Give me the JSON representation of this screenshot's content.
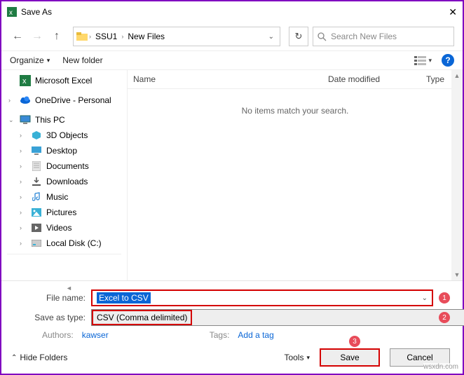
{
  "title": "Save As",
  "nav": {
    "crumb1": "SSU1",
    "crumb2": "New Files",
    "search_placeholder": "Search New Files"
  },
  "toolbar": {
    "organize": "Organize",
    "new_folder": "New folder"
  },
  "tree": {
    "excel": "Microsoft Excel",
    "onedrive": "OneDrive - Personal",
    "thispc": "This PC",
    "objects3d": "3D Objects",
    "desktop": "Desktop",
    "documents": "Documents",
    "downloads": "Downloads",
    "music": "Music",
    "pictures": "Pictures",
    "videos": "Videos",
    "localdisk": "Local Disk (C:)"
  },
  "list": {
    "col_name": "Name",
    "col_date": "Date modified",
    "col_type": "Type",
    "empty": "No items match your search."
  },
  "form": {
    "filename_label": "File name:",
    "filename_value": "Excel to CSV",
    "type_label": "Save as type:",
    "type_value": "CSV (Comma delimited)",
    "authors_label": "Authors:",
    "authors_value": "kawser",
    "tags_label": "Tags:",
    "tags_value": "Add a tag"
  },
  "actions": {
    "hide": "Hide Folders",
    "tools": "Tools",
    "save": "Save",
    "cancel": "Cancel"
  },
  "badges": {
    "b1": "1",
    "b2": "2",
    "b3": "3"
  },
  "watermark": "wsxdn.com"
}
